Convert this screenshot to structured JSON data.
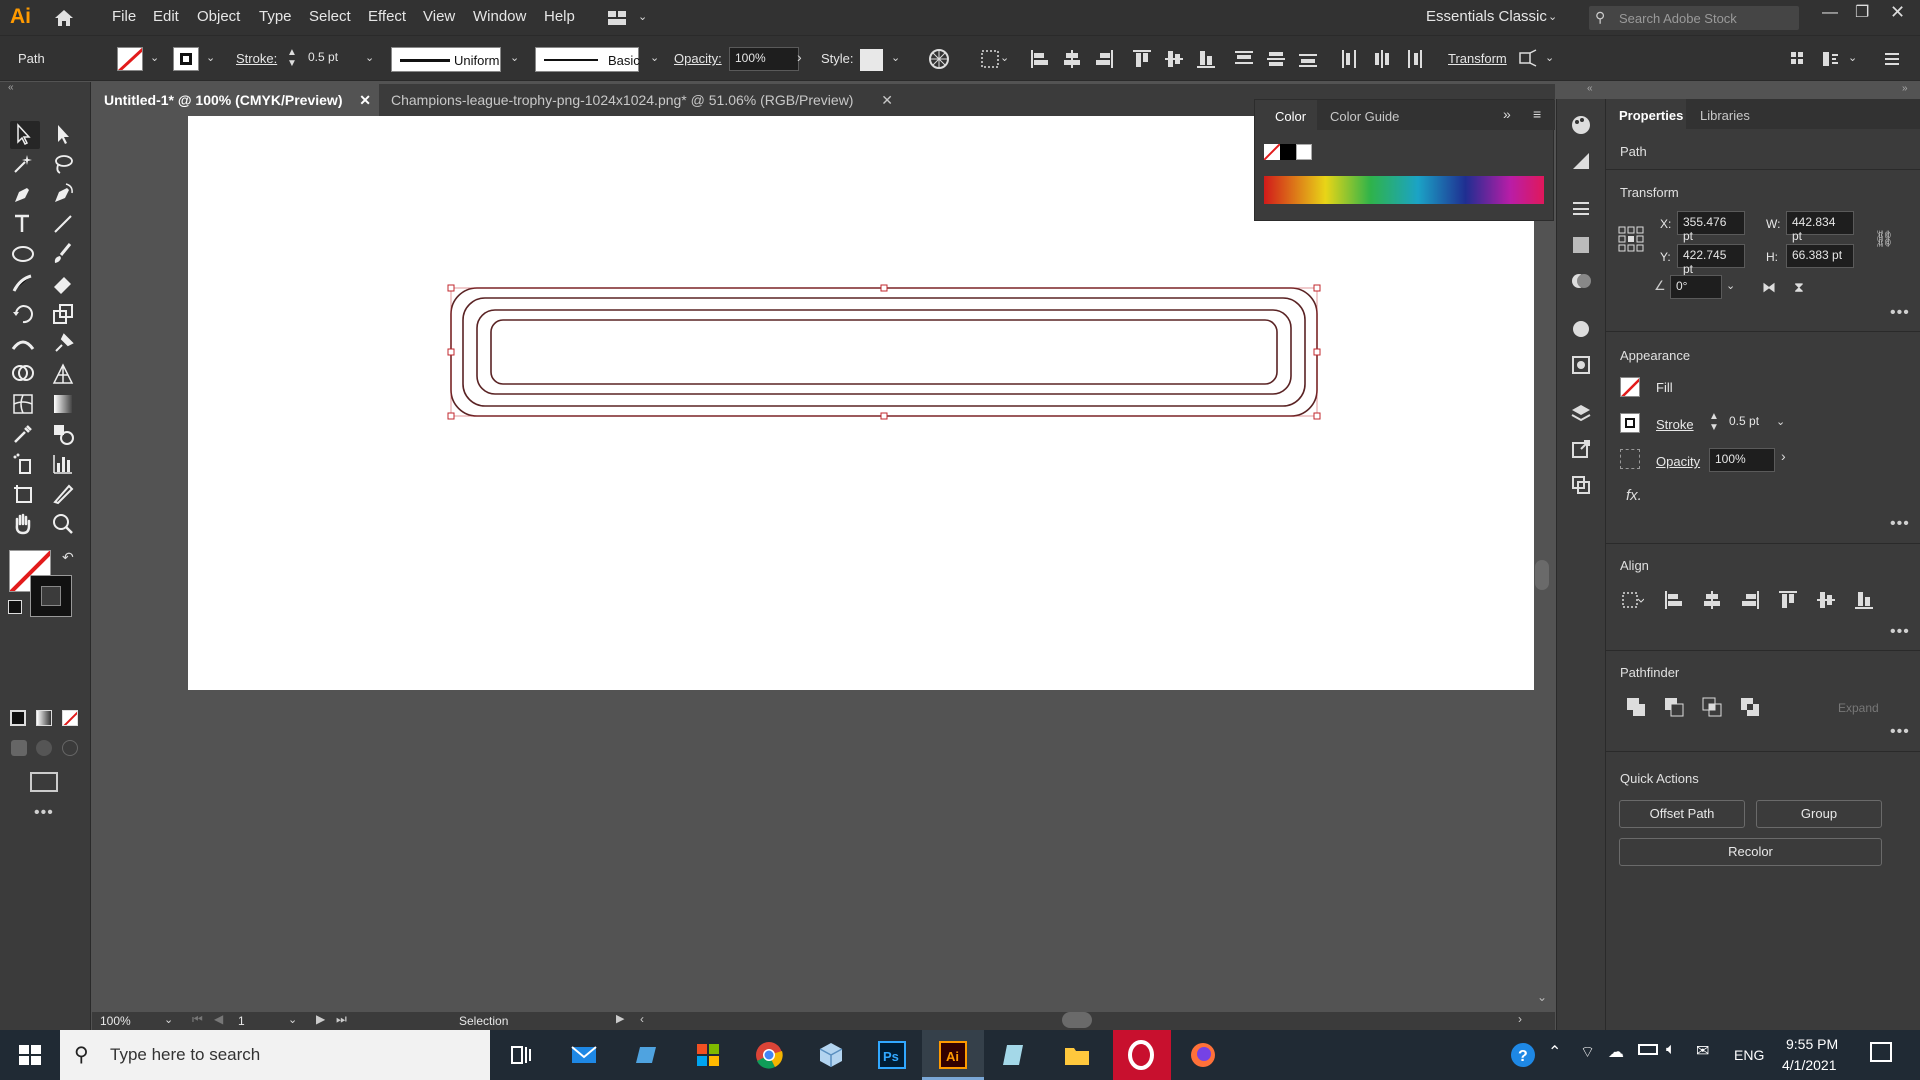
{
  "app": {
    "logo": "Ai"
  },
  "menu": [
    "File",
    "Edit",
    "Object",
    "Type",
    "Select",
    "Effect",
    "View",
    "Window",
    "Help"
  ],
  "workspace": "Essentials Classic",
  "search_placeholder": "Search Adobe Stock",
  "control": {
    "selection_type": "Path",
    "stroke_label": "Stroke:",
    "stroke_value": "0.5 pt",
    "profile_uniform": "Uniform",
    "brush_basic": "Basic",
    "opacity_label": "Opacity:",
    "opacity_value": "100%",
    "style_label": "Style:",
    "transform_label": "Transform"
  },
  "tabs": [
    {
      "label": "Untitled-1* @ 100% (CMYK/Preview)",
      "active": true
    },
    {
      "label": "Champions-league-trophy-png-1024x1024.png* @ 51.06% (RGB/Preview)",
      "active": false
    }
  ],
  "color_panel": {
    "tab_color": "Color",
    "tab_guide": "Color Guide"
  },
  "properties": {
    "tab_properties": "Properties",
    "tab_libraries": "Libraries",
    "selection": "Path",
    "transform_title": "Transform",
    "x_label": "X:",
    "x_value": "355.476 pt",
    "y_label": "Y:",
    "y_value": "422.745 pt",
    "w_label": "W:",
    "w_value": "442.834 pt",
    "h_label": "H:",
    "h_value": "66.383 pt",
    "angle_value": "0°",
    "appearance_title": "Appearance",
    "fill_label": "Fill",
    "stroke_label": "Stroke",
    "stroke_value": "0.5 pt",
    "opacity_label": "Opacity",
    "opacity_value": "100%",
    "fx_label": "fx.",
    "align_title": "Align",
    "pathfinder_title": "Pathfinder",
    "expand_label": "Expand",
    "quick_actions_title": "Quick Actions",
    "offset_path": "Offset Path",
    "group": "Group",
    "recolor": "Recolor"
  },
  "status": {
    "zoom": "100%",
    "page": "1",
    "tool": "Selection"
  },
  "taskbar": {
    "search_placeholder": "Type here to search",
    "lang": "ENG",
    "time": "9:55 PM",
    "date": "4/1/2021"
  },
  "colors": {
    "selection": "#c1272d",
    "accent_ai": "#ff9a00"
  }
}
